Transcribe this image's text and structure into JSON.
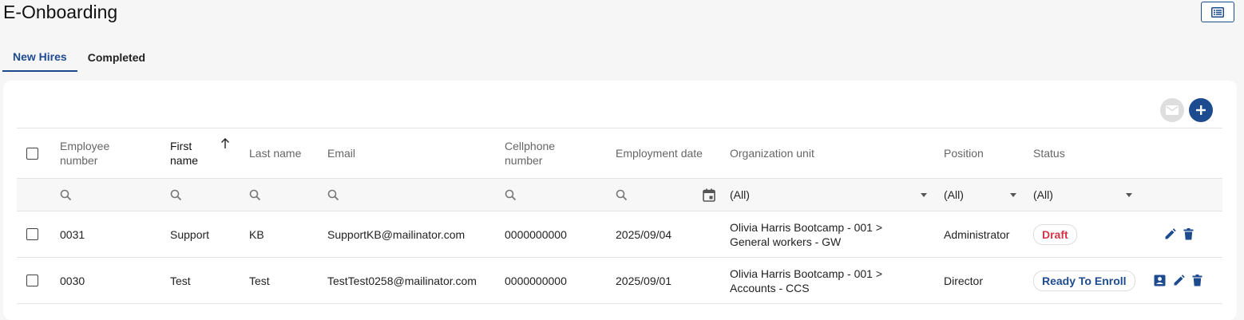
{
  "page": {
    "title": "E-Onboarding"
  },
  "tabs": [
    {
      "label": "New Hires",
      "active": true
    },
    {
      "label": "Completed",
      "active": false
    }
  ],
  "columns": {
    "employee_number": [
      "Employee",
      "number"
    ],
    "first_name": [
      "First",
      "name"
    ],
    "last_name": "Last name",
    "email": "Email",
    "cellphone": [
      "Cellphone",
      "number"
    ],
    "employment_date": "Employment date",
    "org_unit": "Organization unit",
    "position": "Position",
    "status": "Status"
  },
  "filters": {
    "org_unit": "(All)",
    "position": "(All)",
    "status": "(All)"
  },
  "rows": [
    {
      "employee_number": "0031",
      "first_name": "Support",
      "last_name": "KB",
      "email": "SupportKB@mailinator.com",
      "cellphone": "0000000000",
      "employment_date": "2025/09/04",
      "org_unit": [
        "Olivia Harris Bootcamp - 001 >",
        "General workers - GW"
      ],
      "position": "Administrator",
      "status": "Draft"
    },
    {
      "employee_number": "0030",
      "first_name": "Test",
      "last_name": "Test",
      "email": "TestTest0258@mailinator.com",
      "cellphone": "0000000000",
      "employment_date": "2025/09/01",
      "org_unit": [
        "Olivia Harris Bootcamp - 001 >",
        "Accounts - CCS"
      ],
      "position": "Director",
      "status": "Ready To Enroll"
    }
  ],
  "icons": {
    "view_toggle": "list-view-icon",
    "mail": "mail-icon",
    "add": "plus-icon",
    "search": "search-icon",
    "calendar": "calendar-icon",
    "edit": "pencil-icon",
    "delete": "trash-icon",
    "profile": "profile-card-icon"
  },
  "colors": {
    "accent": "#1d4b8f",
    "draft": "#d1354a",
    "disabled": "#dedede"
  }
}
